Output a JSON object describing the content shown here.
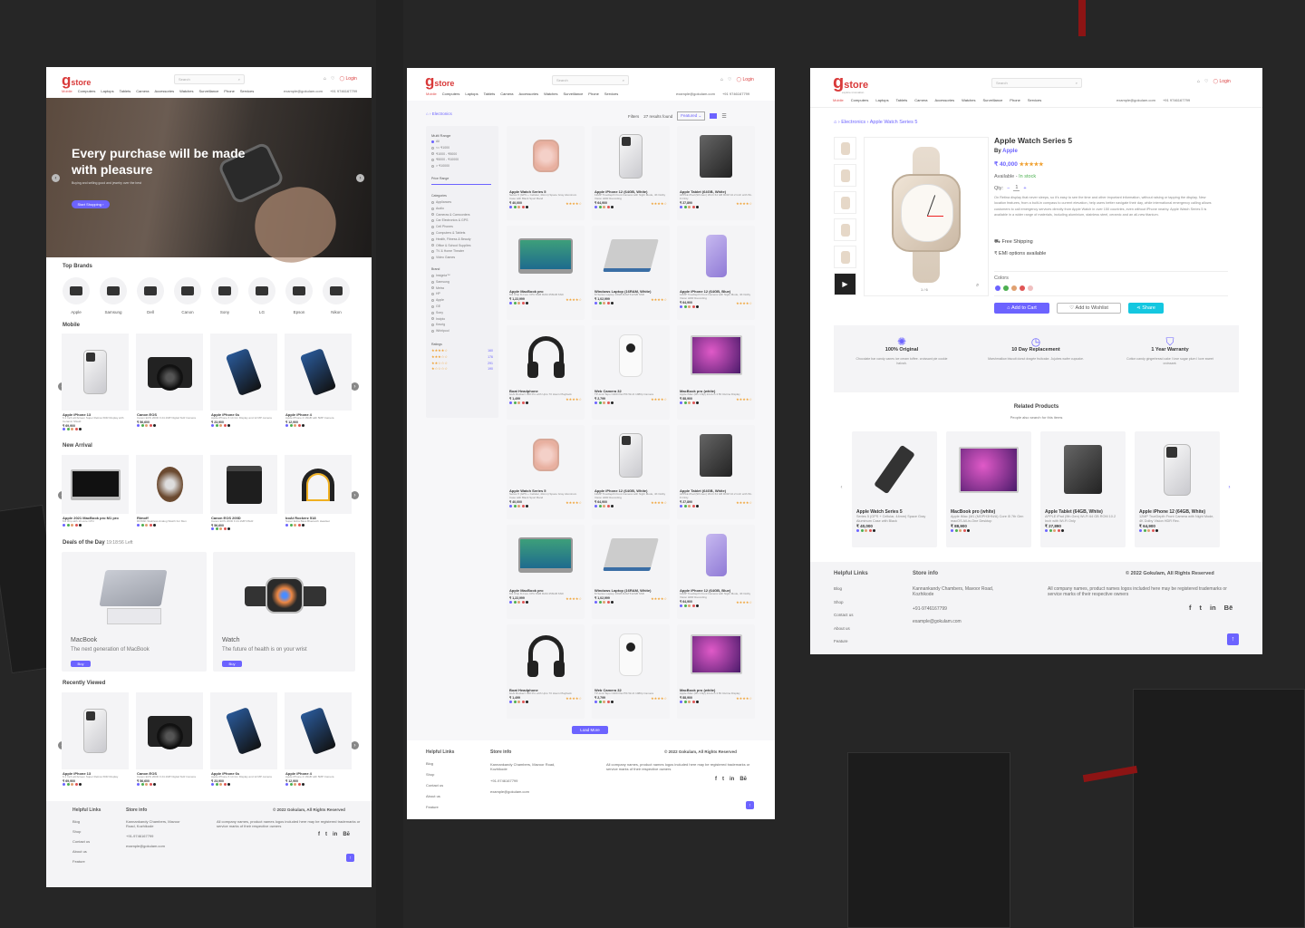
{
  "brand": {
    "logo_g": "g",
    "logo_text": "store",
    "tagline": "explore innovation"
  },
  "nav": [
    "Mobile",
    "Computers",
    "Laptops",
    "Tablets",
    "Camera",
    "Accessories",
    "Watches",
    "Surveillance",
    "Phone",
    "Services"
  ],
  "search_placeholder": "Search",
  "login": "Login",
  "contact": {
    "email": "example@gokulam.com",
    "phone": "+91 9746167799"
  },
  "home": {
    "hero_title": "Every purchase will be made with pleasure",
    "hero_sub": "Buying and selling good and jewelry over the best",
    "hero_btn": "Start Shopping",
    "top_brands_title": "Top Brands",
    "brands": [
      "Apple",
      "Samsung",
      "Dell",
      "Canon",
      "Sony",
      "LG",
      "Epson",
      "Nikon"
    ],
    "mobile_title": "Mobile",
    "mobile": [
      {
        "name": "Apple iPhone 13",
        "desc": "6.1 Inch all-Screen Super Retina XDR Display with Ceramic Shield",
        "price": "₹ 69,900"
      },
      {
        "name": "Canon EOS",
        "desc": "Canon EOS 200D II 24.1MP Digital SLR Camera",
        "price": "₹ 56,600"
      },
      {
        "name": "Apple iPhone 6s",
        "desc": "Apple iPhone 6 14 Cm Display and 12 MP camera",
        "price": "₹ 23,900"
      },
      {
        "name": "Apple iPhone 4",
        "desc": "Apple iPhone 4 16GB with 5MP Camera",
        "price": "₹ 12,900"
      }
    ],
    "new_arrival_title": "New Arrival",
    "new_arrival": [
      {
        "name": "Apple 2021 MacBook pro M1 pro",
        "desc": "M1 chip with 10-core CPU",
        "price": ""
      },
      {
        "name": "Rimoff",
        "desc": "ROSSK Stainless Analog Watch For Men",
        "price": ""
      },
      {
        "name": "Canon EOS 200D",
        "desc": "Canon EOS 200D II 24.1MP DSLR",
        "price": "₹ 56,600"
      },
      {
        "name": "boAt Rockerz 518",
        "desc": "Super Extra Bass Bluetooth Headset",
        "price": ""
      }
    ],
    "deals_title": "Deals of the Day",
    "deals_timer": "19:18:56 Left",
    "deal1": {
      "title": "MacBook",
      "sub": "The next generation of MacBook",
      "btn": "Buy"
    },
    "deal2": {
      "title": "Watch",
      "sub": "The future of health is on your wrist",
      "btn": "Buy"
    },
    "recent_title": "Recently Viewed",
    "recent": [
      {
        "name": "Apple iPhone 13",
        "desc": "6.1 Inch all-Screen Super Retina XDR Display",
        "price": "₹ 69,900"
      },
      {
        "name": "Canon EOS",
        "desc": "Canon EOS 200D II 24.1MP Digital SLR Camera",
        "price": "₹ 56,600"
      },
      {
        "name": "Apple iPhone 6s",
        "desc": "Apple iPhone 6 14 Cm Display and 12 MP camera",
        "price": "₹ 23,900"
      },
      {
        "name": "Apple iPhone 4",
        "desc": "Apple iPhone 4 16GB with 5MP Camera",
        "price": "₹ 12,900"
      }
    ]
  },
  "listing": {
    "breadcrumb": "Electronics",
    "filters_label": "Filters",
    "results": "27 results found",
    "sort": "Featured",
    "multi_range": "Multi Range",
    "ranges": [
      "All",
      "<= ₹1000",
      "₹1000 - ₹5000",
      "₹5000 - ₹10000",
      "> ₹10000"
    ],
    "price_range": "Price Range",
    "categories_title": "Categories",
    "categories": [
      "Appliances",
      "Audio",
      "Cameras & Camcorders",
      "Car Electronics & GPS",
      "Cell Phones",
      "Computers & Tablets",
      "Health, Fitness & Beauty",
      "Office & School Supplies",
      "TV & Home Theater",
      "Video Games"
    ],
    "brand_title": "Brand",
    "brands": [
      "Insignia™",
      "Samsung",
      "Metra",
      "HP",
      "Apple",
      "GE",
      "Sony",
      "Incipio",
      "Keurig",
      "Whirlpool"
    ],
    "ratings_title": "Ratings",
    "ratings": [
      "160",
      "176",
      "291",
      "190"
    ],
    "products": [
      {
        "name": "Apple Watch Series 5",
        "desc": "Series 5 (GPS + Cellular, 44mm) Space Gray Aluminum Case with Black Sport Band",
        "price": "₹ 40,000"
      },
      {
        "name": "Apple iPhone 12 (64GB, White)",
        "desc": "12MP TrueDepth Front Camera with Night Mode, 4K Dolby Vision HDR Recording",
        "price": "₹ 64,900"
      },
      {
        "name": "Apple Tablet (64GB, White)",
        "desc": "APPLE iPad (9th Gen) Wi-Fi 64 GB ROM 10.2 Inch with Wi-Fi Only",
        "price": "₹ 27,890"
      },
      {
        "name": "Apple MacBook pro",
        "desc": "M1 Chip 8-Core CPU 8GB RAM 256GB SSD",
        "price": "₹ 1,22,999"
      },
      {
        "name": "Windows Laptop (16RAM, White)",
        "desc": "M Series Laptop 16GB RAM 512GB SSD",
        "price": "₹ 1,02,999"
      },
      {
        "name": "Apple iPhone 12 (64GB, Blue)",
        "desc": "12MP TrueDepth Front Camera with Night Mode, 4K Dolby Vision HDR Recording",
        "price": "₹ 64,900"
      },
      {
        "name": "Boat Headphone",
        "desc": "boAt Rockerz 450 Pro with Upto 70 Hours Playback",
        "price": "₹ 1,499"
      },
      {
        "name": "Web Camera 32",
        "desc": "TP-Link Tapo C200 Pan/Tilt Wi-Fi 1080p Camera",
        "price": "₹ 2,799"
      },
      {
        "name": "MacBook pro (white)",
        "desc": "Apple iMac (M1 Chip) 24-inch 4.5K Retina Display",
        "price": "₹ 88,900"
      }
    ],
    "load_more": "Load More"
  },
  "detail": {
    "breadcrumb": [
      "Electronics",
      "Apple Watch Series 5"
    ],
    "title": "Apple Watch Series 5",
    "by": "By",
    "brand": "Apple",
    "price": "₹ 40,000",
    "availability_label": "Available -",
    "availability": "In stock",
    "qty_label": "Qty:",
    "qty": "1",
    "desc": "On Retina display that never sleeps, so it's easy to see the time and other important information, without raising or tapping the display. New location features, from a built-in compass to current elevation, help users better navigate their day, while international emergency calling allows customers to call emergency services directly from Apple Watch in over 150 countries, even without iPhone nearby. Apple Watch Series 5 is available in a wider range of materials, including aluminium, stainless steel, ceramic and an all-new titanium.",
    "free_shipping": "Free Shipping",
    "emi": "EMI options available",
    "colors_label": "Colors",
    "add_cart": "Add to Cart",
    "wishlist": "Add to Wishlist",
    "share": "Share",
    "pager": "1 / 6",
    "features": [
      {
        "title": "100% Original",
        "desc": "Chocolate bar candy canes ice cream toffee. croissant pie cookie halvah."
      },
      {
        "title": "10 Day Replacement",
        "desc": "Marshmallow biscuit donut dragée fruitcake. Jujubes wafer cupcake."
      },
      {
        "title": "1 Year Warranty",
        "desc": "Cotton candy gingerbread cake I love sugar plum I love sweet croissant."
      }
    ],
    "related_title": "Related Products",
    "related_sub": "People also search for this items",
    "related": [
      {
        "name": "Apple Watch Series 5",
        "desc": "Series 5 (GPS + Cellular, 44mm) Space Gray Aluminum Case with Black",
        "price": "₹ 40,000"
      },
      {
        "name": "MacBook pro (white)",
        "desc": "Apple iMac (M1 (MGPH3HN/A) Core i5 7th Gen macOS All-in-One Desktop",
        "price": "₹ 88,900"
      },
      {
        "name": "Apple Tablet (64GB, White)",
        "desc": "APPLE iPad (9th Gen) Wi-Fi 64 GB ROM 10.2 Inch with Wi-Fi Only",
        "price": "₹ 27,890"
      },
      {
        "name": "Apple iPhone 12 (64GB, White)",
        "desc": "12MP TrueDepth Front Camera with Night Mode, 4K Dolby Vision HDR Rec.",
        "price": "₹ 64,900"
      }
    ]
  },
  "footer": {
    "helpful_title": "Helpful Links",
    "helpful": [
      "Blog",
      "Shop",
      "Contact us",
      "About us",
      "Feature"
    ],
    "store_title": "Store info",
    "address": "Kannankandy Chambers, Mavoor Road, Kozhikode",
    "phone": "+91-9746167799",
    "email": "example@gokulam.com",
    "copyright": "© 2022 Gokulam, All Rights Reserved",
    "disclaimer": "All company names, product names logos included here may be registered trademarks or service marks of their respective owners",
    "social": [
      "f",
      "t",
      "in",
      "Bē"
    ]
  }
}
